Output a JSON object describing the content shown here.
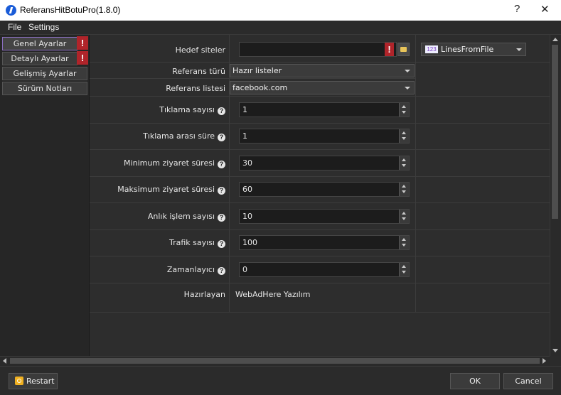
{
  "window": {
    "title": "ReferansHitBotuPro(1.8.0)",
    "help_label": "?",
    "close_label": "✕"
  },
  "menu": [
    "File",
    "Settings"
  ],
  "sidebar": {
    "items": [
      {
        "label": "Genel Ayarlar",
        "warning": "!"
      },
      {
        "label": "Detaylı Ayarlar",
        "warning": "!"
      },
      {
        "label": "Gelişmiş Ayarlar"
      },
      {
        "label": "Sürüm Notları"
      }
    ]
  },
  "form": {
    "target_sites": {
      "label": "Hedef siteler",
      "value": "",
      "warning": "!"
    },
    "source_combo": {
      "badge": "123",
      "value": "LinesFromFile"
    },
    "referrer_type": {
      "label": "Referans türü",
      "value": "Hazır listeler"
    },
    "referrer_list": {
      "label": "Referans listesi",
      "value": "facebook.com"
    },
    "click_count": {
      "label": "Tıklama sayısı",
      "value": "1"
    },
    "click_interval": {
      "label": "Tıklama arası süre",
      "value": "1"
    },
    "min_visit": {
      "label": "Minimum ziyaret süresi",
      "value": "30"
    },
    "max_visit": {
      "label": "Maksimum ziyaret süresi",
      "value": "60"
    },
    "concurrent": {
      "label": "Anlık işlem sayısı",
      "value": "10"
    },
    "traffic": {
      "label": "Trafik sayısı",
      "value": "100"
    },
    "scheduler": {
      "label": "Zamanlayıcı",
      "value": "0"
    },
    "author": {
      "label": "Hazırlayan",
      "value": "WebAdHere Yazılım"
    },
    "help_glyph": "?"
  },
  "buttons": {
    "restart": "Restart",
    "ok": "OK",
    "cancel": "Cancel"
  }
}
